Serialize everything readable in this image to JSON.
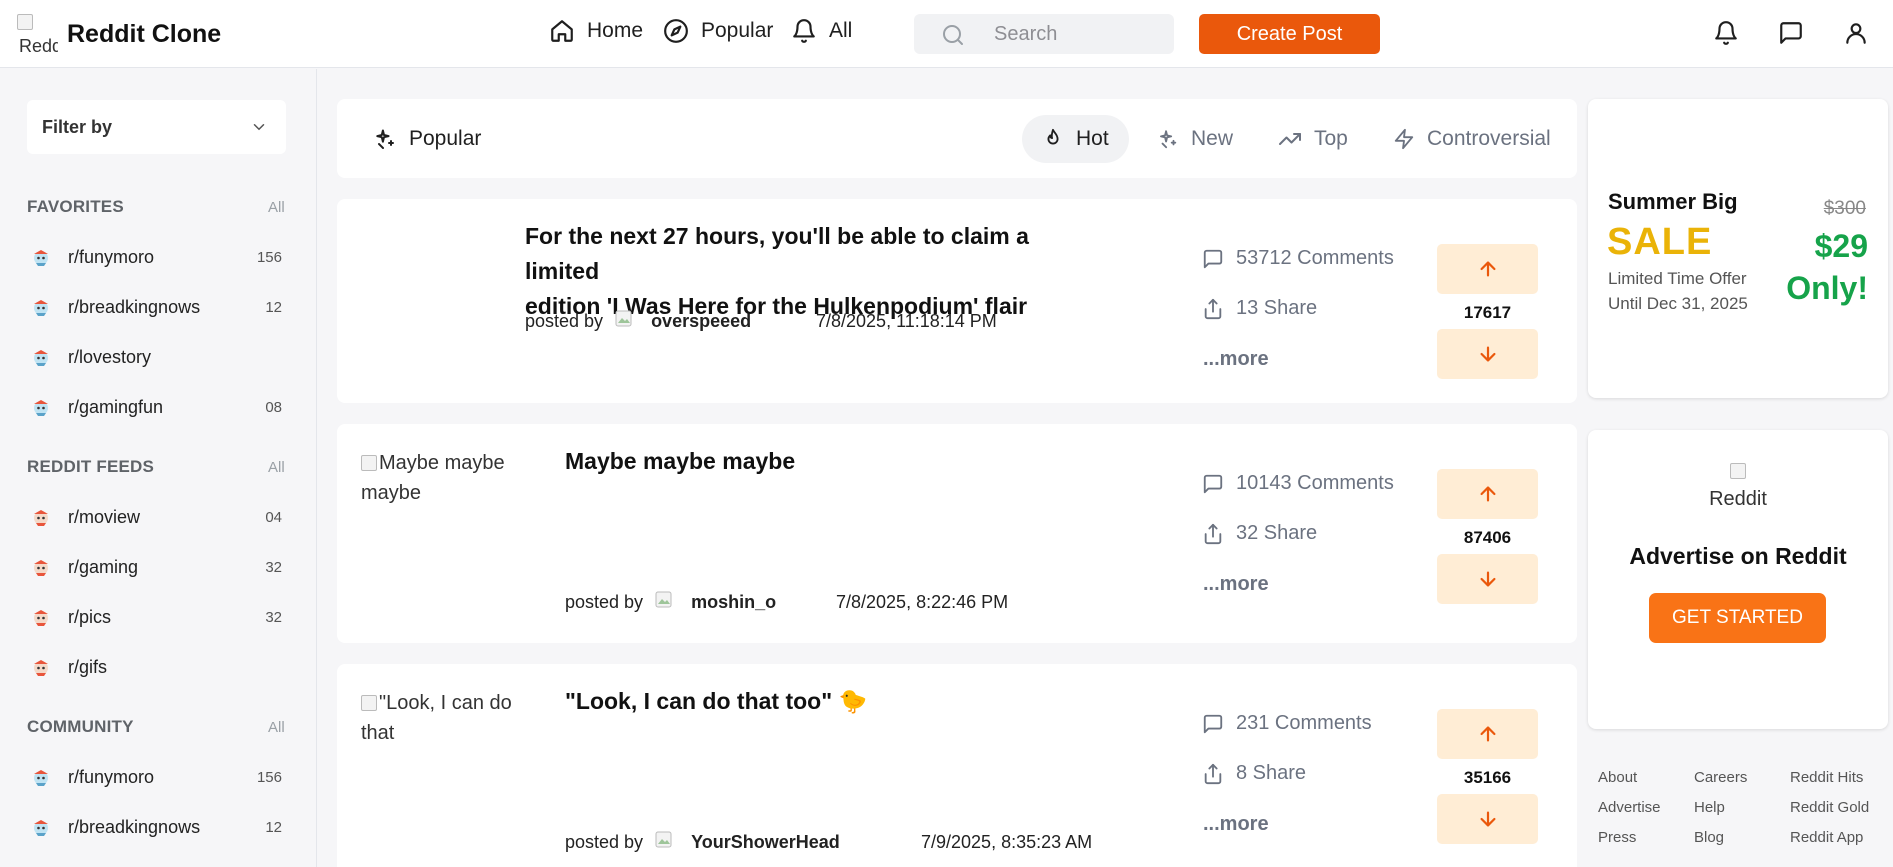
{
  "header": {
    "logo_alt": "Reddit",
    "brand": "Reddit Clone",
    "nav": [
      {
        "label": "Home",
        "icon": "home-icon"
      },
      {
        "label": "Popular",
        "icon": "compass-icon"
      },
      {
        "label": "All",
        "icon": "bell-icon"
      }
    ],
    "search_placeholder": "Search",
    "create_label": "Create Post",
    "icons": [
      "notifications-icon",
      "chat-icon",
      "user-icon"
    ]
  },
  "sidebar": {
    "filter_label": "Filter by",
    "sections": [
      {
        "title": "FAVORITES",
        "all_label": "All",
        "items": [
          {
            "name": "r/funymoro",
            "count": "156"
          },
          {
            "name": "r/breadkingnows",
            "count": "12"
          },
          {
            "name": "r/lovestory",
            "count": ""
          },
          {
            "name": "r/gamingfun",
            "count": "08"
          }
        ]
      },
      {
        "title": "REDDIT FEEDS",
        "all_label": "All",
        "items": [
          {
            "name": "r/moview",
            "count": "04"
          },
          {
            "name": "r/gaming",
            "count": "32"
          },
          {
            "name": "r/pics",
            "count": "32"
          },
          {
            "name": "r/gifs",
            "count": ""
          }
        ]
      },
      {
        "title": "COMMUNITY",
        "all_label": "All",
        "items": [
          {
            "name": "r/funymoro",
            "count": "156"
          },
          {
            "name": "r/breadkingnows",
            "count": "12"
          }
        ]
      }
    ]
  },
  "sortbar": {
    "popular_label": "Popular",
    "options": [
      {
        "label": "Hot",
        "active": true
      },
      {
        "label": "New",
        "active": false
      },
      {
        "label": "Top",
        "active": false
      },
      {
        "label": "Controversial",
        "active": false
      }
    ]
  },
  "posts": [
    {
      "thumb_alt": "",
      "title_line1": "For the next 27 hours, you'll be able to claim a limited",
      "title_line2": "edition 'I Was Here for the Hulkenpodium' flair",
      "posted_by": "posted by",
      "author": "overspeeed",
      "date": "7/8/2025, 11:18:14 PM",
      "comments": "53712 Comments",
      "share": "13 Share",
      "more": "...more",
      "score": "17617"
    },
    {
      "thumb_alt": "Maybe maybe maybe",
      "title_line1": "Maybe maybe maybe",
      "title_line2": "",
      "posted_by": "posted by",
      "author": "moshin_o",
      "date": "7/8/2025, 8:22:46 PM",
      "comments": "10143 Comments",
      "share": "32 Share",
      "more": "...more",
      "score": "87406"
    },
    {
      "thumb_alt": "\"Look, I can do that",
      "title_line1": "\"Look, I can do that too\" 🐤",
      "title_line2": "",
      "posted_by": "posted by",
      "author": "YourShowerHead",
      "date": "7/9/2025, 8:35:23 AM",
      "comments": "231 Comments",
      "share": "8 Share",
      "more": "...more",
      "score": "35166"
    }
  ],
  "ads": {
    "sale": {
      "line1": "Summer Big",
      "line2": "SALE",
      "sub": "Limited Time Offer Until Dec 31, 2025",
      "old_price": "$300",
      "new_price": "$29 Only!"
    },
    "reddit": {
      "img_alt": "Reddit",
      "title": "Advertise on Reddit",
      "button": "GET STARTED"
    }
  },
  "footer": {
    "col1": [
      "About",
      "Advertise",
      "Press"
    ],
    "col2": [
      "Careers",
      "Help",
      "Blog"
    ],
    "col3": [
      "Reddit Hits",
      "Reddit Gold",
      "Reddit App"
    ]
  },
  "colors": {
    "accent": "#ea580c",
    "vote_bg": "#ffedd5",
    "sale_yellow": "#eab308",
    "price_green": "#16a34a"
  }
}
